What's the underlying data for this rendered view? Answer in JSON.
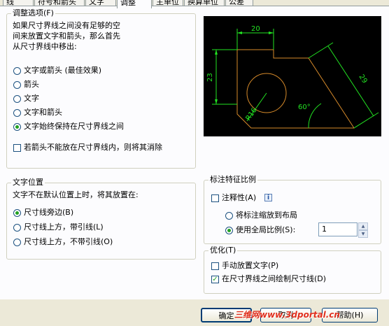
{
  "tabs": [
    {
      "label": "线"
    },
    {
      "label": "符号和箭头"
    },
    {
      "label": "文字"
    },
    {
      "label": "调整"
    },
    {
      "label": "主单位"
    },
    {
      "label": "换算单位"
    },
    {
      "label": "公差"
    }
  ],
  "fit_options": {
    "title": "调整选项(F)",
    "desc_lines": [
      "如果尺寸界线之间没有足够的空",
      "间来放置文字和箭头，那么首先",
      "从尺寸界线中移出:"
    ],
    "radios": [
      {
        "label": "文字或箭头 (最佳效果)",
        "checked": false
      },
      {
        "label": "箭头",
        "checked": false
      },
      {
        "label": "文字",
        "checked": false
      },
      {
        "label": "文字和箭头",
        "checked": false
      },
      {
        "label": "文字始终保持在尺寸界线之间",
        "checked": true
      }
    ],
    "suppress_checkbox": {
      "label": "若箭头不能放在尺寸界线内，则将其消除",
      "checked": false
    }
  },
  "preview": {
    "dim_top": "20",
    "dim_left": "23",
    "dim_diag": "29",
    "dim_angle": "60°",
    "dim_radius": "R16"
  },
  "text_placement": {
    "title": "文字位置",
    "desc": "文字不在默认位置上时，将其放置在:",
    "radios": [
      {
        "label": "尺寸线旁边(B)",
        "checked": true
      },
      {
        "label": "尺寸线上方，带引线(L)",
        "checked": false
      },
      {
        "label": "尺寸线上方，不带引线(O)",
        "checked": false
      }
    ]
  },
  "scale": {
    "title": "标注特征比例",
    "annotative_label": "注释性(A)",
    "annotative_checked": false,
    "info_glyph": "i",
    "radio_layout": {
      "label": "将标注缩放到布局",
      "checked": false
    },
    "radio_global": {
      "label": "使用全局比例(S):",
      "checked": true
    },
    "global_value": "1"
  },
  "finetune": {
    "title": "优化(T)",
    "manual_text": {
      "label": "手动放置文字(P)",
      "checked": false
    },
    "draw_dimline": {
      "label": "在尺寸界线之间绘制尺寸线(D)",
      "checked": true
    }
  },
  "buttons": {
    "ok": "确定",
    "cancel": "取消",
    "help": "帮助(H)"
  },
  "watermark": "三维网www.3dportal.cn",
  "colors": {
    "preview_bg": "#000000",
    "dimension": "#22e322",
    "geometry": "#d68a2a",
    "accent": "#ffc83c"
  }
}
